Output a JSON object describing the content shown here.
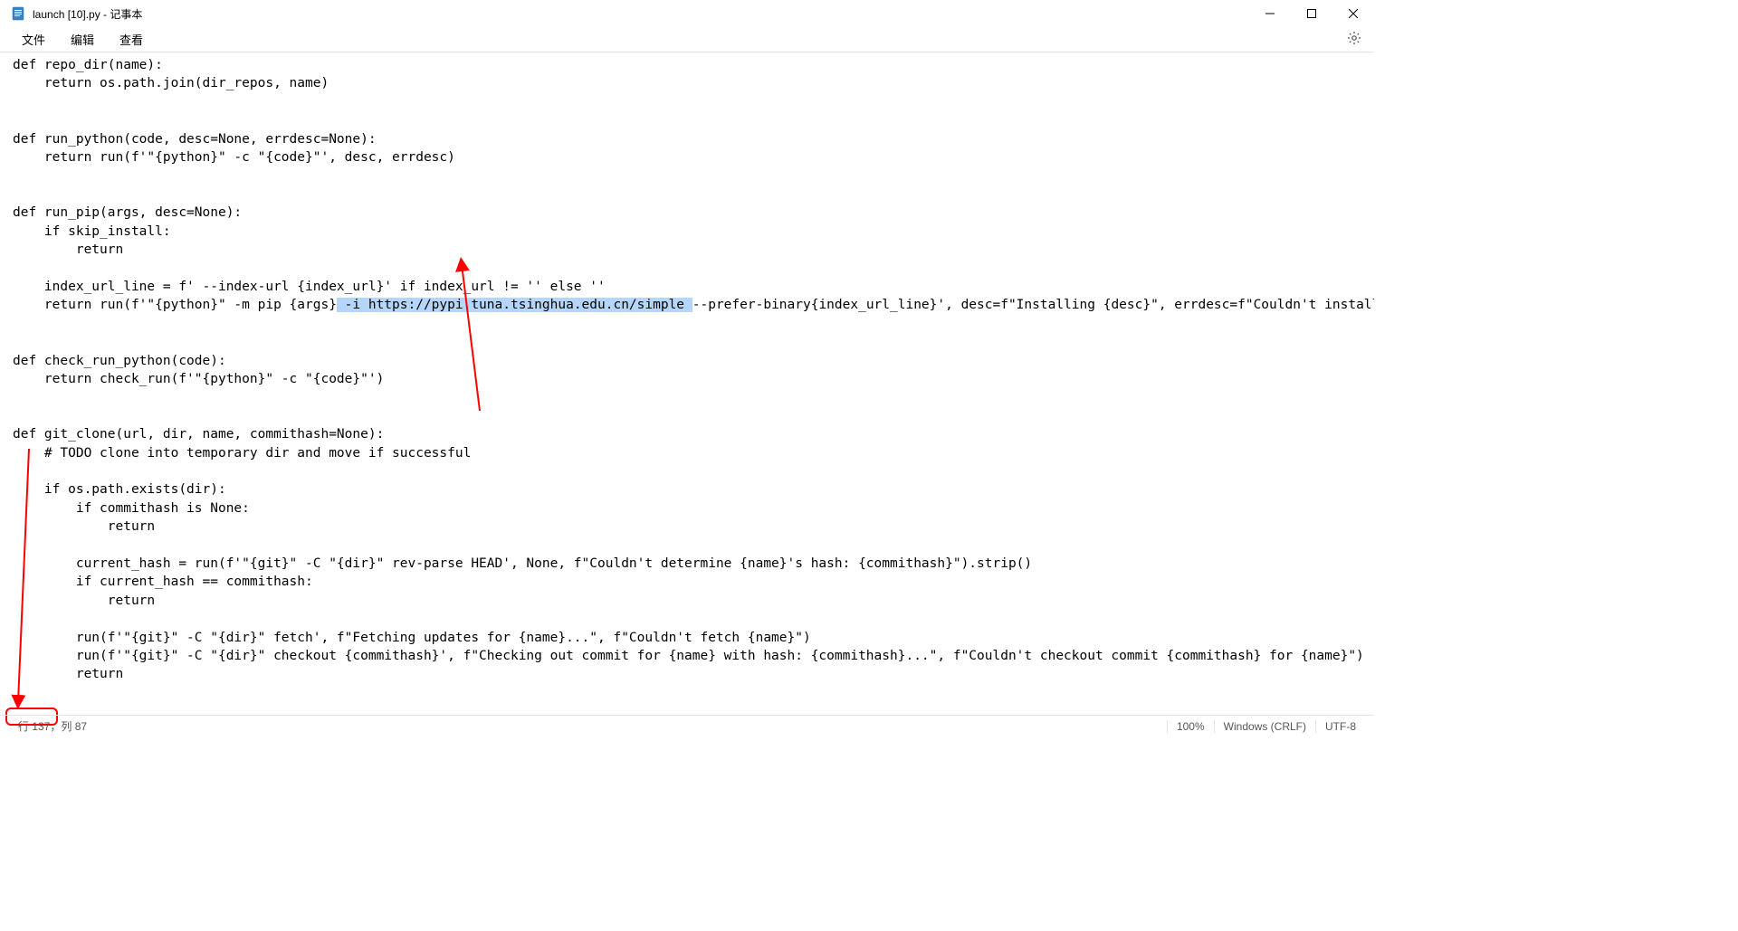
{
  "window": {
    "title": "launch [10].py - 记事本"
  },
  "menu": {
    "file": "文件",
    "edit": "编辑",
    "view": "查看"
  },
  "code": {
    "l1": "def repo_dir(name):",
    "l2": "    return os.path.join(dir_repos, name)",
    "l3": "",
    "l4": "",
    "l5": "def run_python(code, desc=None, errdesc=None):",
    "l6": "    return run(f'\"{python}\" -c \"{code}\"', desc, errdesc)",
    "l7": "",
    "l8": "",
    "l9": "def run_pip(args, desc=None):",
    "l10": "    if skip_install:",
    "l11": "        return",
    "l12": "",
    "l13": "    index_url_line = f' --index-url {index_url}' if index_url != '' else ''",
    "l14a": "    return run(f'\"{python}\" -m pip {args}",
    "l14b": " -i https://pypi.tuna.tsinghua.edu.cn/simple ",
    "l14c": "--prefer-binary{index_url_line}', desc=f\"Installing {desc}\", errdesc=f\"Couldn't install {desc}\")",
    "l15": "",
    "l16": "",
    "l17": "def check_run_python(code):",
    "l18": "    return check_run(f'\"{python}\" -c \"{code}\"')",
    "l19": "",
    "l20": "",
    "l21": "def git_clone(url, dir, name, commithash=None):",
    "l22": "    # TODO clone into temporary dir and move if successful",
    "l23": "",
    "l24": "    if os.path.exists(dir):",
    "l25": "        if commithash is None:",
    "l26": "            return",
    "l27": "",
    "l28": "        current_hash = run(f'\"{git}\" -C \"{dir}\" rev-parse HEAD', None, f\"Couldn't determine {name}'s hash: {commithash}\").strip()",
    "l29": "        if current_hash == commithash:",
    "l30": "            return",
    "l31": "",
    "l32": "        run(f'\"{git}\" -C \"{dir}\" fetch', f\"Fetching updates for {name}...\", f\"Couldn't fetch {name}\")",
    "l33": "        run(f'\"{git}\" -C \"{dir}\" checkout {commithash}', f\"Checking out commit for {name} with hash: {commithash}...\", f\"Couldn't checkout commit {commithash} for {name}\")",
    "l34": "        return"
  },
  "status": {
    "pos": "行 137，列 87",
    "zoom": "100%",
    "eol": "Windows (CRLF)",
    "encoding": "UTF-8"
  }
}
